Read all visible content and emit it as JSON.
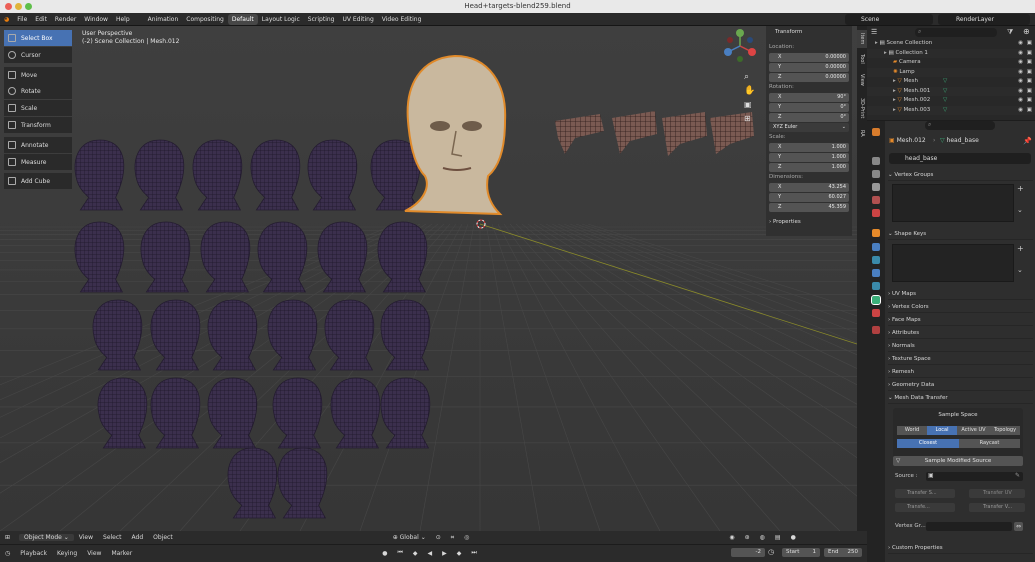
{
  "title_bar": {
    "title": "Head+targets-blend259.blend"
  },
  "menu": {
    "items": [
      "File",
      "Edit",
      "Render",
      "Window",
      "Help"
    ]
  },
  "workspaces": [
    "Animation",
    "Compositing",
    "Default",
    "Layout Logic",
    "Scripting",
    "UV Editing",
    "Video Editing"
  ],
  "active_workspace": "Default",
  "scene": {
    "name": "Scene",
    "render_layer": "RenderLayer"
  },
  "viewport": {
    "perspective": "User Perspective",
    "collection_info": "(-2) Scene Collection | Mesh.012",
    "head_color": "#3b2f4d",
    "selected_color": "#e08a2a"
  },
  "toolbar": [
    {
      "label": "Select Box",
      "icon": "select-box-icon",
      "active": true
    },
    {
      "label": "Cursor",
      "icon": "cursor-icon"
    },
    {
      "label": "Move",
      "icon": "move-icon"
    },
    {
      "label": "Rotate",
      "icon": "rotate-icon"
    },
    {
      "label": "Scale",
      "icon": "scale-icon"
    },
    {
      "label": "Transform",
      "icon": "transform-icon"
    },
    {
      "label": "Annotate",
      "icon": "annotate-icon"
    },
    {
      "label": "Measure",
      "icon": "measure-icon"
    },
    {
      "label": "Add Cube",
      "icon": "add-cube-icon"
    }
  ],
  "transform": {
    "title": "Transform",
    "location_label": "Location:",
    "location": {
      "x": "0.00000",
      "y": "0.00000",
      "z": "0.00000"
    },
    "rotation_label": "Rotation:",
    "rotation": {
      "x": "90°",
      "y": "0°",
      "z": "0°"
    },
    "rotation_mode": "XYZ Euler",
    "scale_label": "Scale:",
    "scale": {
      "x": "1.000",
      "y": "1.000",
      "z": "1.000"
    },
    "dimensions_label": "Dimensions:",
    "dimensions": {
      "x": "43.254",
      "y": "60.027",
      "z": "45.359"
    },
    "properties_label": "Properties"
  },
  "n_tabs": [
    "Item",
    "Tool",
    "View",
    "3D-Print",
    "RA"
  ],
  "outliner": {
    "search_placeholder": "",
    "rows": [
      {
        "label": "Scene Collection",
        "indent": 0,
        "type": "collection"
      },
      {
        "label": "Collection 1",
        "indent": 1,
        "type": "collection"
      },
      {
        "label": "Camera",
        "indent": 2,
        "type": "camera"
      },
      {
        "label": "Lamp",
        "indent": 2,
        "type": "light"
      },
      {
        "label": "Mesh",
        "indent": 2,
        "type": "mesh"
      },
      {
        "label": "Mesh.001",
        "indent": 2,
        "type": "mesh"
      },
      {
        "label": "Mesh.002",
        "indent": 2,
        "type": "mesh"
      },
      {
        "label": "Mesh.003",
        "indent": 2,
        "type": "mesh"
      }
    ]
  },
  "properties": {
    "object_name": "Mesh.012",
    "data_name": "head_base",
    "mesh_field": "head_base",
    "vertex_groups": "Vertex Groups",
    "shape_keys": "Shape Keys",
    "sections": [
      "UV Maps",
      "Vertex Colors",
      "Face Maps",
      "Attributes",
      "Normals",
      "Texture Space",
      "Remesh",
      "Geometry Data"
    ],
    "mesh_data_transfer": "Mesh Data Transfer",
    "sample_space_label": "Sample Space",
    "sample_space_options": [
      "World",
      "Local",
      "Active UV",
      "Topology"
    ],
    "sample_space_active": "Local",
    "closest": "Closest",
    "raycast": "Raycast",
    "sample_modified": "Sample Modified Source",
    "source_label": "Source :",
    "transfer_shape": "Transfer S...",
    "transfer_uv": "Transfer UV",
    "transfer_shape2": "Transfe...",
    "transfer_vertex": "Transfer V...",
    "vertex_group_label": "Vertex Gr...",
    "custom_properties": "Custom Properties"
  },
  "header": {
    "mode": "Object Mode",
    "menus": [
      "View",
      "Select",
      "Add",
      "Object"
    ],
    "orientation": "Global"
  },
  "timeline": {
    "menus": [
      "Playback",
      "Keying",
      "View",
      "Marker"
    ],
    "current_frame": "-2",
    "start_label": "Start",
    "start": "1",
    "end_label": "End",
    "end": "250"
  }
}
